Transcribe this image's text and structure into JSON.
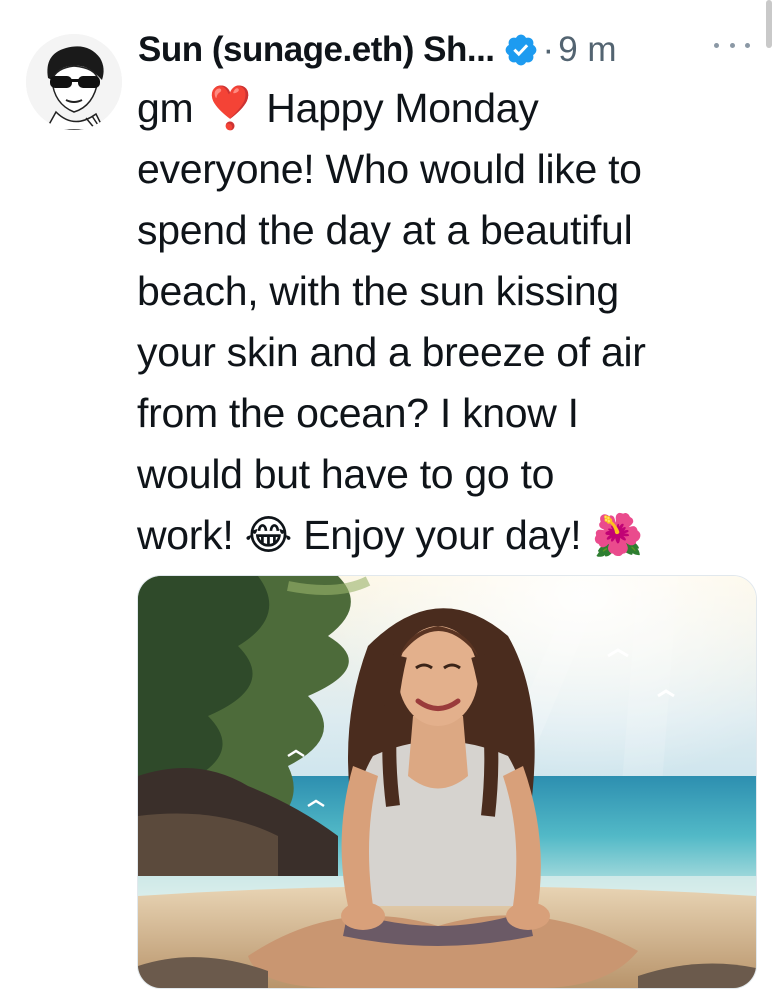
{
  "tweet": {
    "author_display": "Sun (sunage.eth) Sh...",
    "separator": "·",
    "time": "9 m",
    "verified_color": "#1d9bf0",
    "avatar_icon": "user-avatar-sunglasses",
    "more_icon": "more-horizontal-icon",
    "text_lines": [
      "gm ❣️ Happy Monday",
      "everyone! Who would like to",
      "spend the day at a beautiful",
      "beach, with the sun kissing",
      "your skin and a breeze of air",
      "from the ocean? I know I",
      "would but have to go to",
      "work! 😂 Enjoy your day! 🌺"
    ],
    "media": {
      "kind": "illustration",
      "icon": "beach-woman-image"
    }
  }
}
